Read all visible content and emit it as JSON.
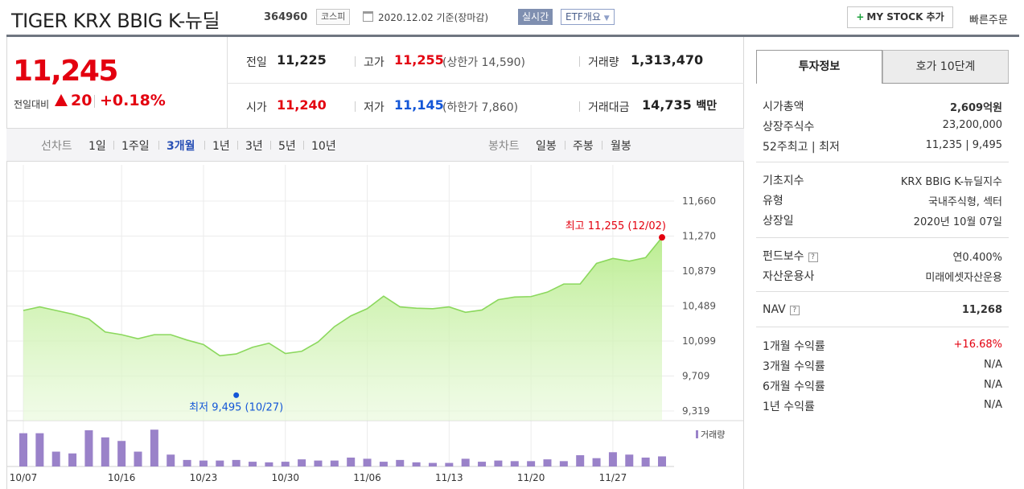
{
  "header": {
    "title": "TIGER KRX BBIG K-뉴딜",
    "code": "364960",
    "market": "코스피",
    "date_text": "2020.12.02  기준(장마감)",
    "realtime_label": "실시간",
    "etf_label": "ETF개요",
    "mystock_label": "MY STOCK 추가",
    "quick_order_label": "빠른주문"
  },
  "price": {
    "current": "11,245",
    "change_label": "전일대비",
    "change": "20",
    "change_pct": "+0.18%"
  },
  "stats": {
    "prev": {
      "label": "전일",
      "value": "11,225"
    },
    "high": {
      "label": "고가",
      "value": "11,255",
      "sub": "(상한가 14,590)"
    },
    "volume": {
      "label": "거래량",
      "value": "1,313,470"
    },
    "open": {
      "label": "시가",
      "value": "11,240"
    },
    "low": {
      "label": "저가",
      "value": "11,145",
      "sub": "(하한가 7,860)"
    },
    "amount": {
      "label": "거래대금",
      "value": "14,735",
      "unit": "백만"
    }
  },
  "period_bar": {
    "line_label": "선차트",
    "periods": [
      "1일",
      "1주일",
      "3개월",
      "1년",
      "3년",
      "5년",
      "10년"
    ],
    "active_period": "3개월",
    "candle_label": "봉차트",
    "candles": [
      "일봉",
      "주봉",
      "월봉"
    ]
  },
  "chart_data": {
    "type": "area",
    "x": [
      "10/07",
      "10/08",
      "10/12",
      "10/13",
      "10/14",
      "10/15",
      "10/16",
      "10/19",
      "10/20",
      "10/21",
      "10/22",
      "10/23",
      "10/26",
      "10/27",
      "10/28",
      "10/29",
      "10/30",
      "11/02",
      "11/03",
      "11/04",
      "11/05",
      "11/06",
      "11/09",
      "11/10",
      "11/11",
      "11/12",
      "11/13",
      "11/16",
      "11/17",
      "11/18",
      "11/19",
      "11/20",
      "11/23",
      "11/24",
      "11/25",
      "11/26",
      "11/27",
      "11/30",
      "12/01",
      "12/02"
    ],
    "values": [
      10440,
      10480,
      10440,
      10400,
      10345,
      10200,
      10170,
      10125,
      10170,
      10170,
      10110,
      10060,
      9935,
      9955,
      10030,
      10075,
      9960,
      9985,
      10090,
      10260,
      10380,
      10460,
      10600,
      10480,
      10465,
      10460,
      10480,
      10420,
      10445,
      10560,
      10590,
      10595,
      10645,
      10735,
      10735,
      10965,
      11020,
      10990,
      11030,
      11255
    ],
    "volume": [
      56,
      56,
      25,
      22,
      61,
      49,
      43,
      25,
      62,
      20,
      11,
      10,
      10,
      11,
      8,
      7,
      8,
      12,
      10,
      10,
      15,
      13,
      8,
      11,
      7,
      6,
      6,
      13,
      8,
      10,
      9,
      9,
      12,
      9,
      19,
      14,
      24,
      20,
      15,
      17
    ],
    "volume_label": "거래량",
    "x_ticks": [
      "10/07",
      "10/16",
      "10/23",
      "10/30",
      "11/06",
      "11/13",
      "11/20",
      "11/27"
    ],
    "y_ticks": [
      "11,660",
      "11,270",
      "10,879",
      "10,489",
      "10,099",
      "9,709",
      "9,319"
    ],
    "ylim": [
      9319,
      11660
    ],
    "max_annotation": "최고 11,255 (12/02)",
    "min_annotation": "최저 9,495 (10/27)",
    "max_value": 11255,
    "min_value": 9495,
    "max_index": 39,
    "min_index": 13,
    "line_color": "#8bd85d",
    "fill_color": "#c8f0a8",
    "bar_color": "#9a82c9",
    "grid": true
  },
  "invest_panel": {
    "tab_info": "투자정보",
    "tab_quote": "호가 10단계",
    "market_cap": {
      "label": "시가총액",
      "value": "2,609억원"
    },
    "shares": {
      "label": "상장주식수",
      "value": "23,200,000"
    },
    "range52": {
      "label": "52주최고 | 최저",
      "value": "11,235 | 9,495"
    },
    "base_index": {
      "label": "기초지수",
      "value": "KRX BBIG K-뉴딜지수"
    },
    "type": {
      "label": "유형",
      "value": "국내주식형, 섹터"
    },
    "listing_date": {
      "label": "상장일",
      "value": "2020년 10월 07일"
    },
    "fee": {
      "label": "펀드보수",
      "value": "연0.400%"
    },
    "manager": {
      "label": "자산운용사",
      "value": "미래에셋자산운용"
    },
    "nav": {
      "label": "NAV",
      "value": "11,268"
    },
    "ret1m": {
      "label": "1개월 수익률",
      "value": "+16.68%"
    },
    "ret3m": {
      "label": "3개월 수익률",
      "value": "N/A"
    },
    "ret6m": {
      "label": "6개월 수익률",
      "value": "N/A"
    },
    "ret1y": {
      "label": "1년 수익률",
      "value": "N/A"
    }
  }
}
